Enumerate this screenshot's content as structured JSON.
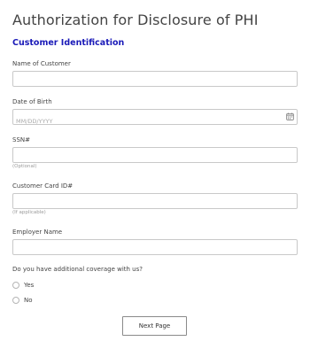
{
  "form": {
    "title": "Authorization for Disclosure of PHI",
    "section_heading": "Customer Identification",
    "fields": {
      "name_of_customer": {
        "label": "Name of Customer",
        "value": "",
        "placeholder": ""
      },
      "date_of_birth": {
        "label": "Date of Birth",
        "value": "",
        "placeholder": "MM/DD/YYYY",
        "icon": "calendar-icon"
      },
      "ssn": {
        "label": "SSN#",
        "value": "",
        "placeholder": "",
        "hint": "(Optional)"
      },
      "customer_card_id": {
        "label": "Customer Card ID#",
        "value": "",
        "placeholder": "",
        "hint": "(If applicable)"
      },
      "employer_name": {
        "label": "Employer Name",
        "value": "",
        "placeholder": ""
      }
    },
    "additional_coverage": {
      "question": "Do you have additional coverage with us?",
      "options": [
        {
          "label": "Yes",
          "selected": false
        },
        {
          "label": "No",
          "selected": false
        }
      ]
    },
    "next_button_label": "Next Page"
  },
  "colors": {
    "section_heading": "#1a1ab8",
    "input_border": "#c9c9c9",
    "button_border": "#8a8a8a"
  }
}
